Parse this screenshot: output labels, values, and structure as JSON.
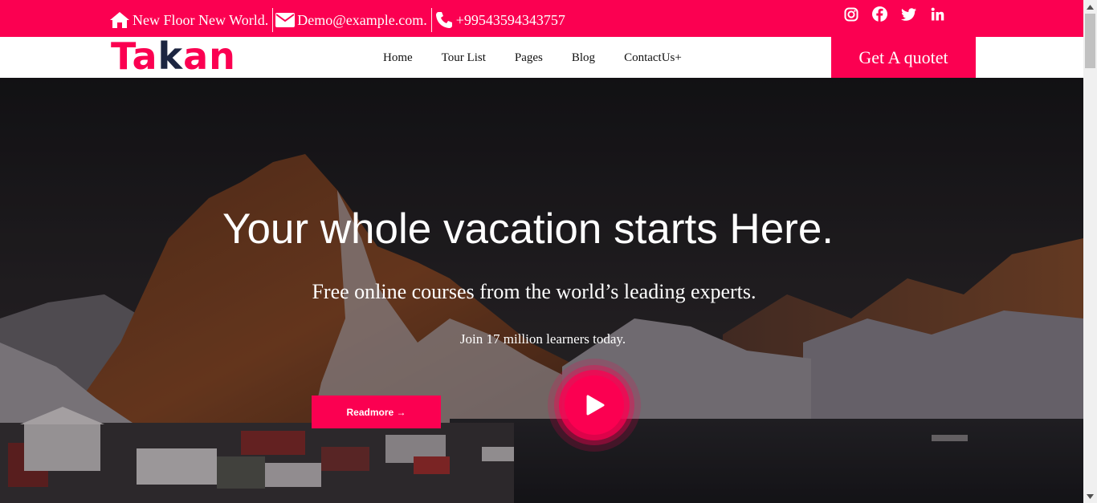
{
  "topbar": {
    "address": "New Floor New World.",
    "email": "Demo@example.com.",
    "phone": "+99543594343757",
    "social_icons": [
      "instagram-icon",
      "facebook-icon",
      "twitter-icon",
      "linkedin-icon"
    ]
  },
  "header": {
    "logo_part1": "Ta",
    "logo_part2": "k",
    "logo_part3": "an",
    "nav": [
      "Home",
      "Tour List",
      "Pages",
      "Blog",
      "ContactUs+"
    ],
    "quote_button": "Get A quotet"
  },
  "hero": {
    "title": "Your whole vacation starts Here.",
    "subtitle": "Free online courses from the world’s leading experts.",
    "tagline": "Join 17 million learners today.",
    "readmore": "Readmore →",
    "play_icon": "play-icon"
  },
  "colors": {
    "accent": "#fb0051",
    "logo_dark": "#1c2540"
  }
}
